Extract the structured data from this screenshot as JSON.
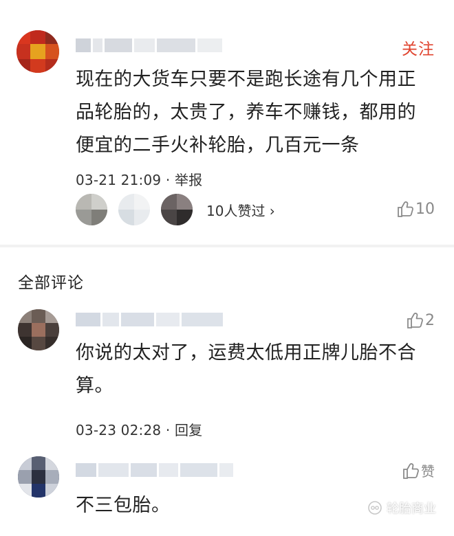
{
  "post": {
    "follow_label": "关注",
    "content": "现在的大货车只要不是跑长途有几个用正品轮胎的，太贵了，养车不赚钱，都用的便宜的二手火补轮胎，几百元一条",
    "meta": "03-21 21:09 · 举报",
    "likers_text": "10人赞过 ›",
    "like_count": "10"
  },
  "comments_header": "全部评论",
  "comments": [
    {
      "content": "你说的太对了，运费太低用正牌儿胎不合算。",
      "meta": "03-23 02:28 · 回复",
      "like_label": "2"
    },
    {
      "content": "不三包胎。",
      "like_label": "赞"
    }
  ],
  "watermark": {
    "text": "轮胎商业"
  },
  "colors": {
    "follow": "#e0442f",
    "divider": "#f2f2f2",
    "text": "#222222",
    "secondary": "#888888"
  },
  "icons": {
    "like": "thumbs-up-icon",
    "watermark": "wechat-channel-icon"
  }
}
